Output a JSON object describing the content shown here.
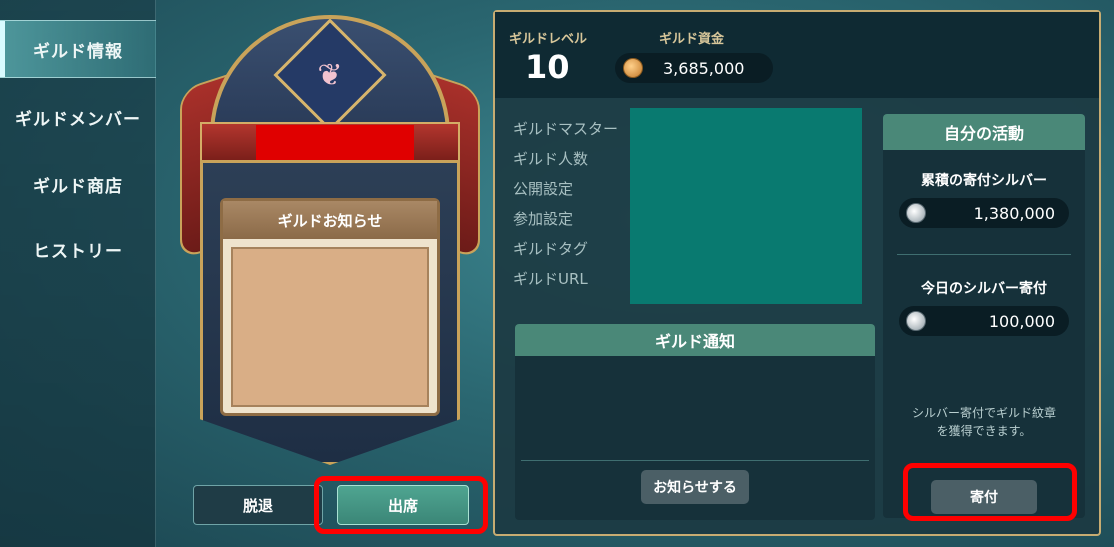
{
  "sidebar": {
    "items": [
      {
        "label": "ギルド情報",
        "active": true
      },
      {
        "label": "ギルドメンバー",
        "active": false
      },
      {
        "label": "ギルド商店",
        "active": false
      },
      {
        "label": "ヒストリー",
        "active": false
      }
    ]
  },
  "banner": {
    "notice_title": "ギルドお知らせ"
  },
  "buttons": {
    "leave": "脱退",
    "attend": "出席"
  },
  "header": {
    "level_label": "ギルドレベル",
    "level_value": "10",
    "funds_label": "ギルド資金",
    "funds_value": "3,685,000"
  },
  "info": {
    "labels": [
      "ギルドマスター",
      "ギルド人数",
      "公開設定",
      "参加設定",
      "ギルドタグ",
      "ギルドURL"
    ]
  },
  "notify": {
    "title": "ギルド通知",
    "button": "お知らせする"
  },
  "activity": {
    "title": "自分の活動",
    "total_label": "累積の寄付シルバー",
    "total_value": "1,380,000",
    "today_label": "今日のシルバー寄付",
    "today_value": "100,000",
    "note_line1": "シルバー寄付でギルド紋章",
    "note_line2": "を獲得できます。",
    "donate_button": "寄付"
  },
  "colors": {
    "accent_red": "#ff0000",
    "panel_gold": "#c7ac72",
    "teal_header": "#4a8878"
  }
}
